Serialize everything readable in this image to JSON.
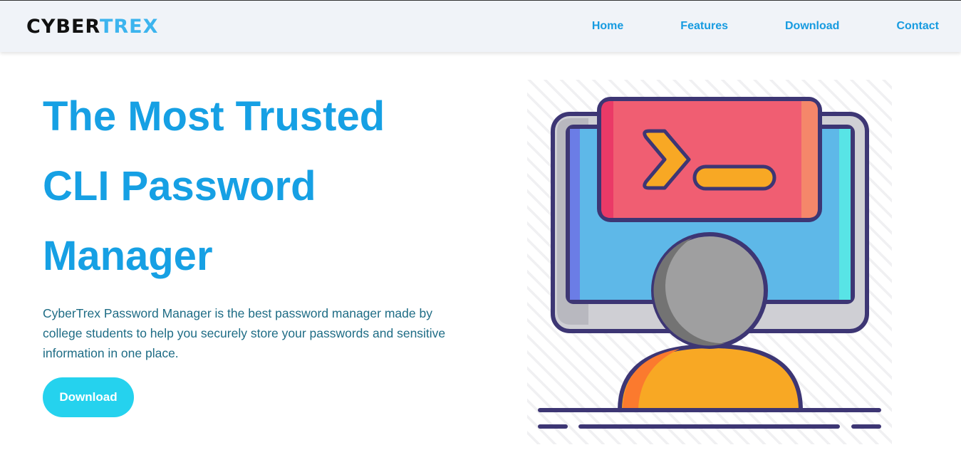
{
  "brand": {
    "part1": "CYBER",
    "part2": "TREX"
  },
  "nav": {
    "home": "Home",
    "features": "Features",
    "download": "Download",
    "contact": "Contact"
  },
  "hero": {
    "title_line1": "The Most Trusted",
    "title_line2": "CLI Password",
    "title_line3": "Manager",
    "description": "CyberTrex Password Manager is the best password manager made by college students to help you securely store your passwords and sensitive information in one place.",
    "cta_label": "Download"
  },
  "colors": {
    "accent": "#16a0e4",
    "button": "#25d2ee",
    "nav_background": "#f0f3f8"
  },
  "illustration": {
    "icon": "terminal-user-computer-icon"
  }
}
